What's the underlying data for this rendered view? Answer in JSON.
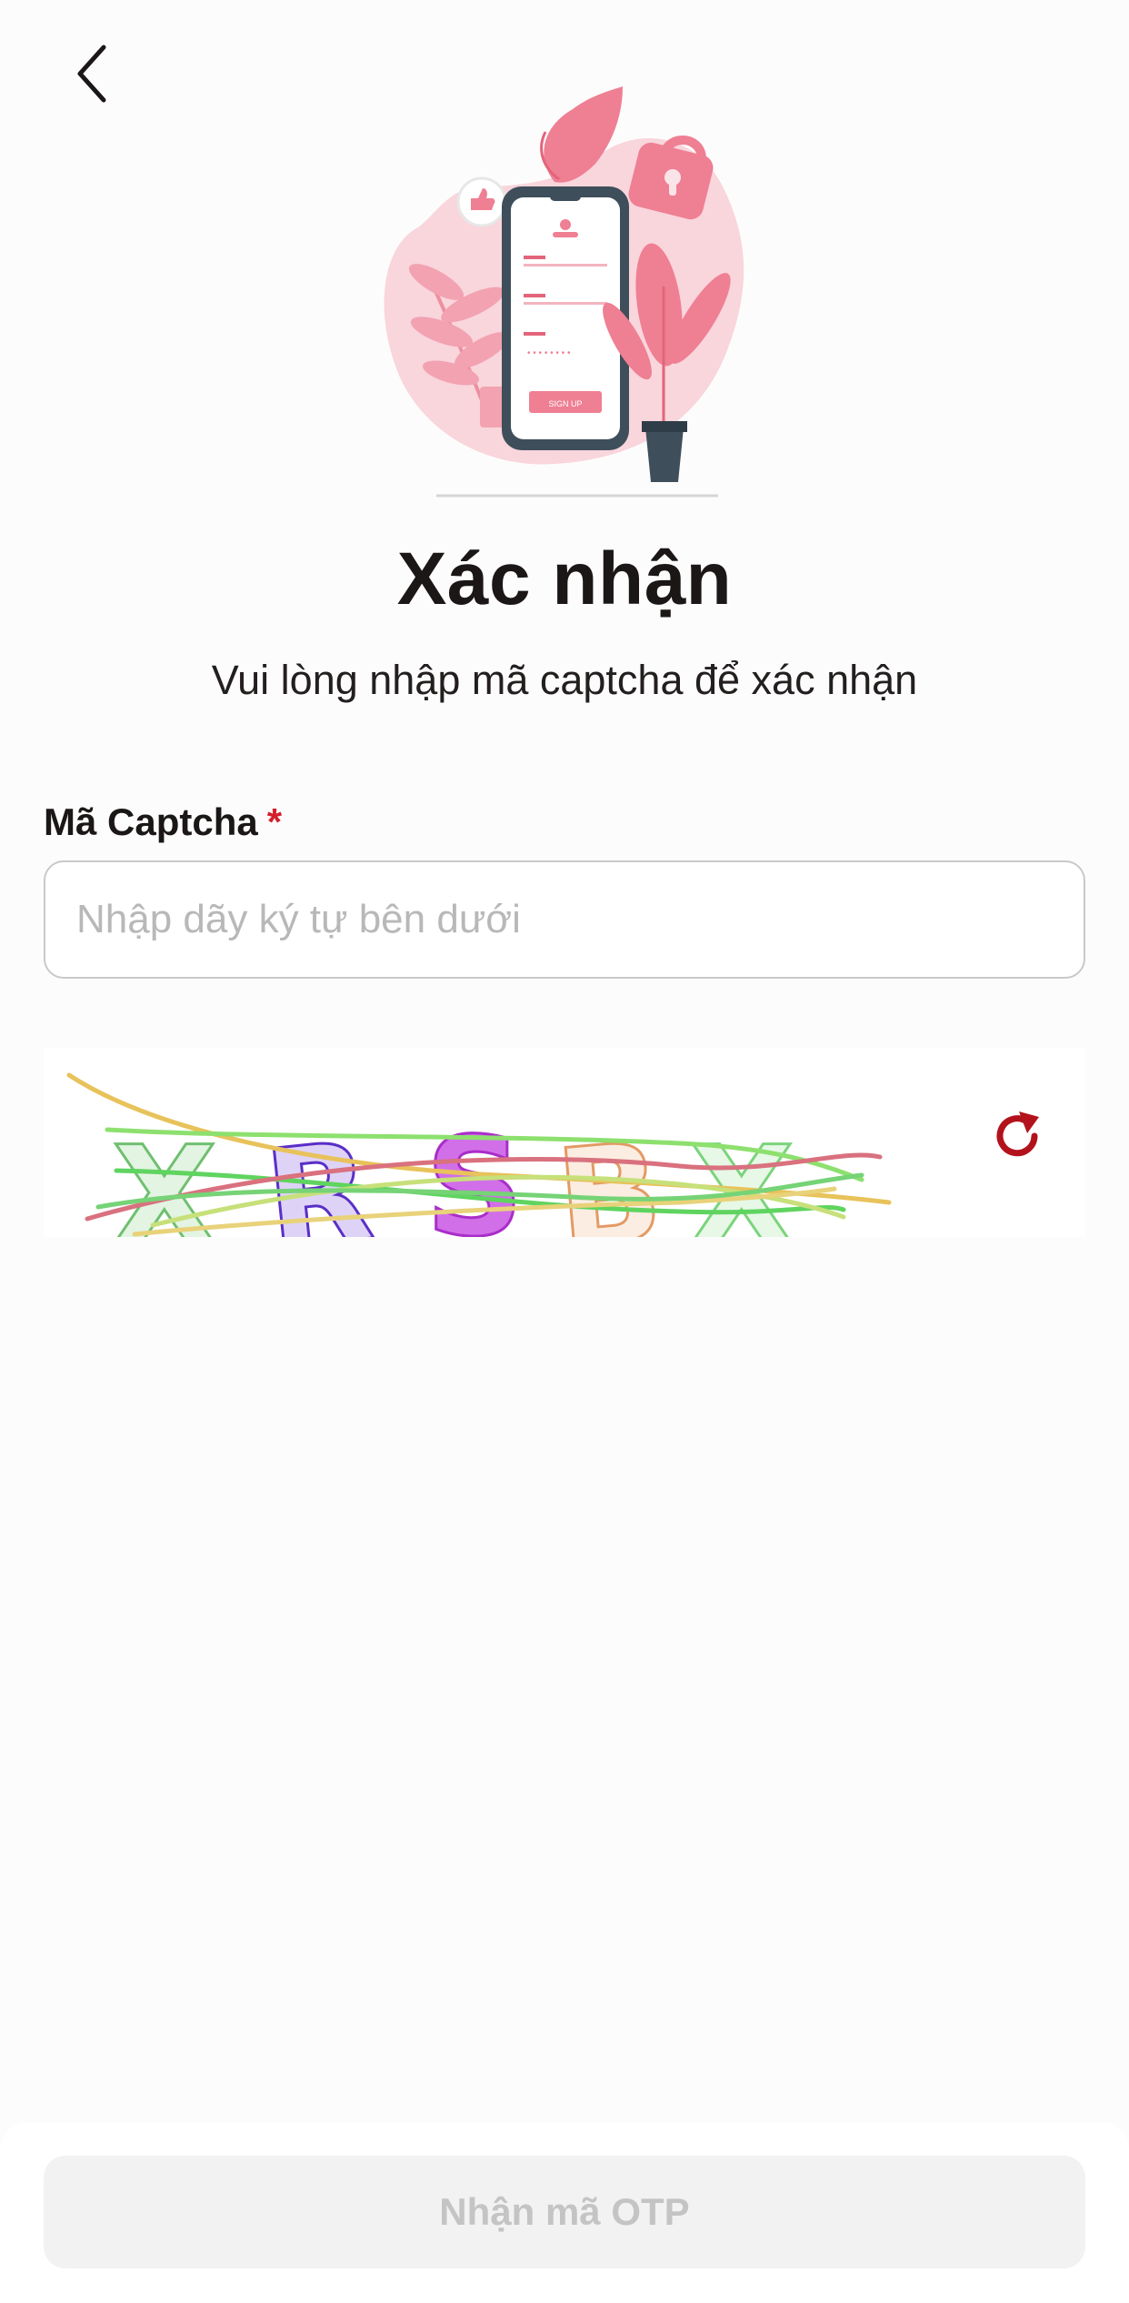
{
  "header": {
    "back_icon": "chevron-left-icon"
  },
  "hero": {
    "illustration": "phone-signup-illustration",
    "button_text": "SIGN UP"
  },
  "title": "Xác nhận",
  "subtitle": "Vui lòng nhập mã captcha để xác nhận",
  "captcha_field": {
    "label": "Mã Captcha",
    "required_mark": "*",
    "placeholder": "Nhập dãy ký tự bên dưới",
    "value": ""
  },
  "captcha_image": {
    "characters": [
      "X",
      "R",
      "S",
      "B",
      "X"
    ],
    "refresh_icon": "refresh-icon"
  },
  "footer": {
    "submit_label": "Nhận mã OTP"
  },
  "colors": {
    "accent": "#d51d2b",
    "refresh": "#b3121c",
    "illustration_pink": "#ef7f93",
    "illustration_dark": "#3e4e5a",
    "disabled_button_bg": "#f2f2f2",
    "disabled_button_text": "#c4c4c4"
  }
}
